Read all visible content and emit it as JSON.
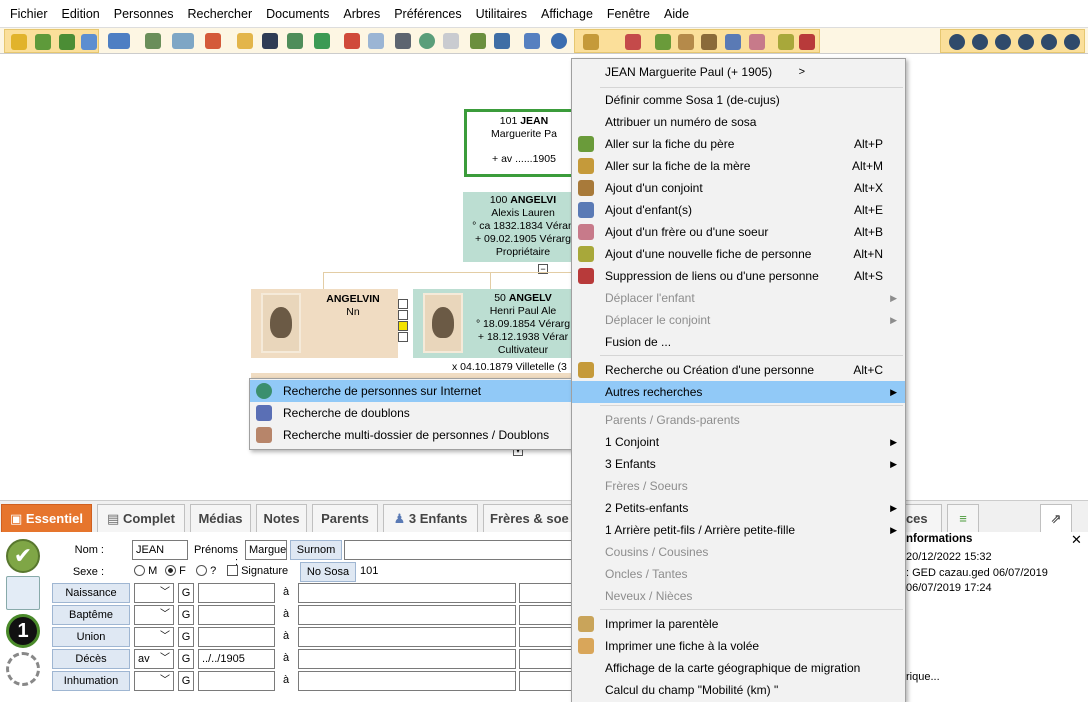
{
  "menubar": [
    "Fichier",
    "Edition",
    "Personnes",
    "Rechercher",
    "Documents",
    "Arbres",
    "Préférences",
    "Utilitaires",
    "Affichage",
    "Fenêtre",
    "Aide"
  ],
  "tree": {
    "root": {
      "sosa": "101",
      "surname": "JEAN",
      "firstname": "Marguerite Pa",
      "death": "+ av ......1905"
    },
    "father": {
      "sosa": "100",
      "surname": "ANGELVI",
      "firstname": "Alexis Lauren",
      "birth": "° ca 1832.1834 Véran",
      "death": "+ 09.02.1905 Vérarg",
      "occupation": "Propriétaire"
    },
    "left_card": {
      "surname": "ANGELVIN",
      "firstname": "Nn"
    },
    "right_card": {
      "sosa": "50",
      "surname": "ANGELV",
      "firstname": "Henri Paul Ale",
      "birth": "° 18.09.1854 Vérarg",
      "death": "+ 18.12.1938 Vérar",
      "occupation": "Cultivateur"
    },
    "marriage": "x 04.10.1879 Villetelle (3"
  },
  "context_menu": {
    "header": "JEAN Marguerite Paul (+  1905)",
    "items": [
      {
        "label": "Définir comme Sosa 1 (de-cujus)",
        "shortcut": "",
        "disabled": false
      },
      {
        "label": "Attribuer un numéro de sosa",
        "shortcut": "",
        "disabled": false
      },
      {
        "label": "Aller sur la fiche du père",
        "shortcut": "Alt+P",
        "disabled": false
      },
      {
        "label": "Aller sur la fiche de la mère",
        "shortcut": "Alt+M",
        "disabled": false
      },
      {
        "label": "Ajout d'un conjoint",
        "shortcut": "Alt+X",
        "disabled": false
      },
      {
        "label": "Ajout d'enfant(s)",
        "shortcut": "Alt+E",
        "disabled": false
      },
      {
        "label": "Ajout d'un frère ou d'une soeur",
        "shortcut": "Alt+B",
        "disabled": false
      },
      {
        "label": "Ajout d'une nouvelle fiche de personne",
        "shortcut": "Alt+N",
        "disabled": false
      },
      {
        "label": "Suppression de liens ou d'une personne",
        "shortcut": "Alt+S",
        "disabled": false
      },
      {
        "label": "Déplacer l'enfant",
        "shortcut": "",
        "disabled": true
      },
      {
        "label": "Déplacer le conjoint",
        "shortcut": "",
        "disabled": true
      },
      {
        "label": "Fusion de ...",
        "shortcut": "",
        "disabled": false
      },
      {
        "label": "Recherche ou Création d'une personne",
        "shortcut": "Alt+C",
        "disabled": false
      },
      {
        "label": "Autres recherches",
        "shortcut": "",
        "disabled": false
      },
      {
        "label": "Parents / Grands-parents",
        "shortcut": "",
        "disabled": true
      },
      {
        "label": "1 Conjoint",
        "shortcut": "",
        "disabled": false
      },
      {
        "label": "3 Enfants",
        "shortcut": "",
        "disabled": false
      },
      {
        "label": "Frères / Soeurs",
        "shortcut": "",
        "disabled": true
      },
      {
        "label": "2 Petits-enfants",
        "shortcut": "",
        "disabled": false
      },
      {
        "label": "1 Arrière petit-fils / Arrière petite-fille",
        "shortcut": "",
        "disabled": false
      },
      {
        "label": "Cousins / Cousines",
        "shortcut": "",
        "disabled": true
      },
      {
        "label": "Oncles / Tantes",
        "shortcut": "",
        "disabled": true
      },
      {
        "label": "Neveux / Nièces",
        "shortcut": "",
        "disabled": true
      },
      {
        "label": "Imprimer la parentèle",
        "shortcut": "",
        "disabled": false
      },
      {
        "label": "Imprimer une fiche à la volée",
        "shortcut": "",
        "disabled": false
      },
      {
        "label": "Affichage de la carte géographique de migration",
        "shortcut": "",
        "disabled": false
      },
      {
        "label": "Calcul du champ \"Mobilité (km) \"",
        "shortcut": "",
        "disabled": false
      }
    ]
  },
  "submenu": {
    "items": [
      "Recherche de personnes sur Internet",
      "Recherche de doublons",
      "Recherche multi-dossier de personnes / Doublons"
    ]
  },
  "tabs": {
    "essentiel": "Essentiel",
    "complet": "Complet",
    "medias": "Médias",
    "notes": "Notes",
    "parents": "Parents",
    "enfants": "3 Enfants",
    "freres": "Frères & soe",
    "notices": "tices"
  },
  "form": {
    "nom_label": "Nom :",
    "nom_value": "JEAN",
    "prenoms_label": "Prénoms :",
    "prenoms_value": "Margue",
    "surnom_label": "Surnom",
    "sexe_label": "Sexe :",
    "sexe_m": "M",
    "sexe_f": "F",
    "sexe_q": "?",
    "signature_label": "Signature",
    "nososa_label": "No Sosa",
    "nososa_value": "101",
    "events": [
      {
        "label": "Naissance",
        "qual": "",
        "g": "G",
        "date": "",
        "a": "à"
      },
      {
        "label": "Baptême",
        "qual": "",
        "g": "G",
        "date": "",
        "a": "à"
      },
      {
        "label": "Union",
        "qual": "",
        "g": "G",
        "date": "",
        "a": "à"
      },
      {
        "label": "Décès",
        "qual": "av",
        "g": "G",
        "date": "../../1905",
        "a": "à"
      },
      {
        "label": "Inhumation",
        "qual": "",
        "g": "G",
        "date": "",
        "a": "à"
      }
    ],
    "side_number": "1"
  },
  "info_panel": {
    "title": "nformations",
    "line1": "20/12/2022 15:32",
    "line2": ":   GED cazau.ged 06/07/2019",
    "line3": "06/07/2019 17:24",
    "footer": "rique..."
  }
}
